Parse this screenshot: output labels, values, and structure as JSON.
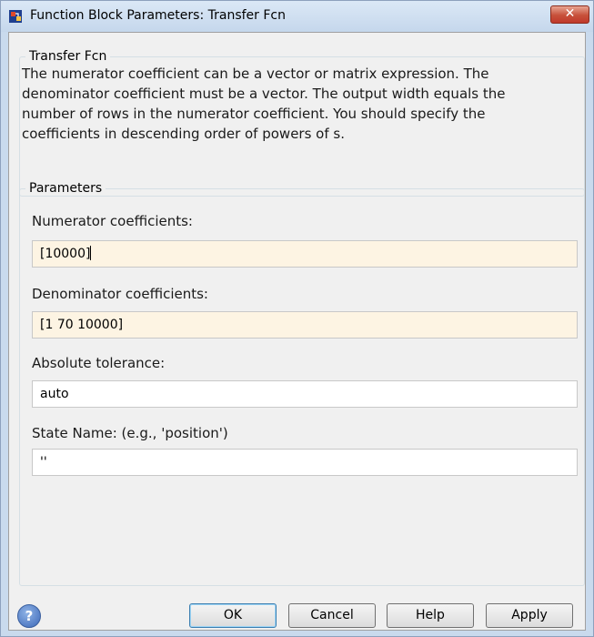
{
  "window": {
    "title": "Function Block Parameters: Transfer Fcn",
    "close_glyph": "✕"
  },
  "block": {
    "name": "Transfer Fcn",
    "description": "The numerator coefficient can be a vector or matrix expression. The denominator coefficient must be a vector. The output width equals the number of rows in the numerator coefficient. You should specify the coefficients in descending order of powers of s."
  },
  "parameters": {
    "group_label": "Parameters",
    "fields": [
      {
        "label": "Numerator coefficients:",
        "value": "[10000]"
      },
      {
        "label": "Denominator coefficients:",
        "value": "[1 70 10000]"
      },
      {
        "label": "Absolute tolerance:",
        "value": "auto"
      },
      {
        "label": "State Name: (e.g., 'position')",
        "value": "''"
      }
    ]
  },
  "buttons": {
    "help_icon": "?",
    "ok": "OK",
    "cancel": "Cancel",
    "help": "Help",
    "apply": "Apply"
  },
  "colors": {
    "highlight_field": "#fdf4e3",
    "title_bar": "#c9daed",
    "close_button": "#c7503a"
  }
}
